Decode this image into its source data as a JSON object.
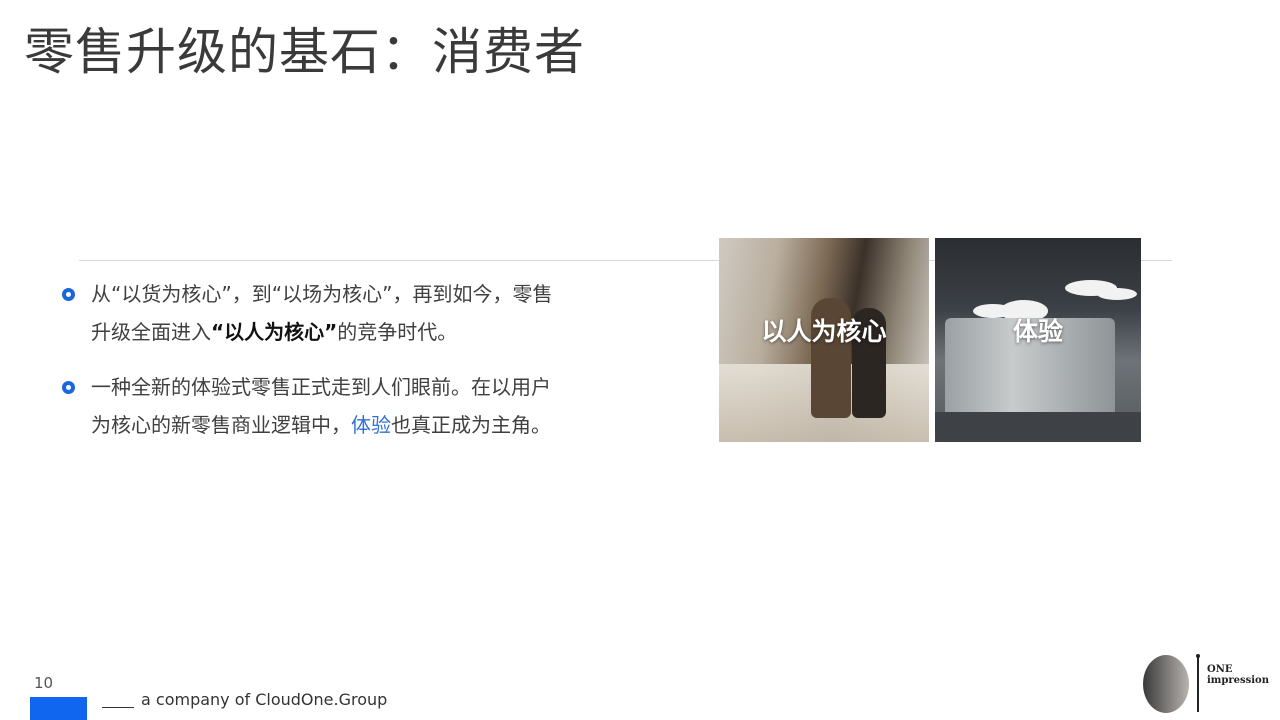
{
  "slide": {
    "title": "零售升级的基石：消费者",
    "page_number": "10"
  },
  "bullets": [
    {
      "line1": "从“以货为核心”，到“以场为核心”，再到如今，零售",
      "line2_pre": "升级全面进入",
      "line2_bold": "“以人为核心”",
      "line2_post": "的竞争时代。"
    },
    {
      "line1": "一种全新的体验式零售正式走到人们眼前。在以用户",
      "line2_pre": "为核心的新零售商业逻辑中，",
      "line2_highlight": "体验",
      "line2_post": "也真正成为主角。"
    }
  ],
  "images": [
    {
      "label": "以人为核心"
    },
    {
      "label": "体验"
    }
  ],
  "footer": {
    "company_text": "a company of CloudOne.Group",
    "logo_line1": "ONE",
    "logo_line2": "impression"
  },
  "colors": {
    "accent_blue": "#1166f0",
    "highlight_blue": "#2f6fd6"
  }
}
